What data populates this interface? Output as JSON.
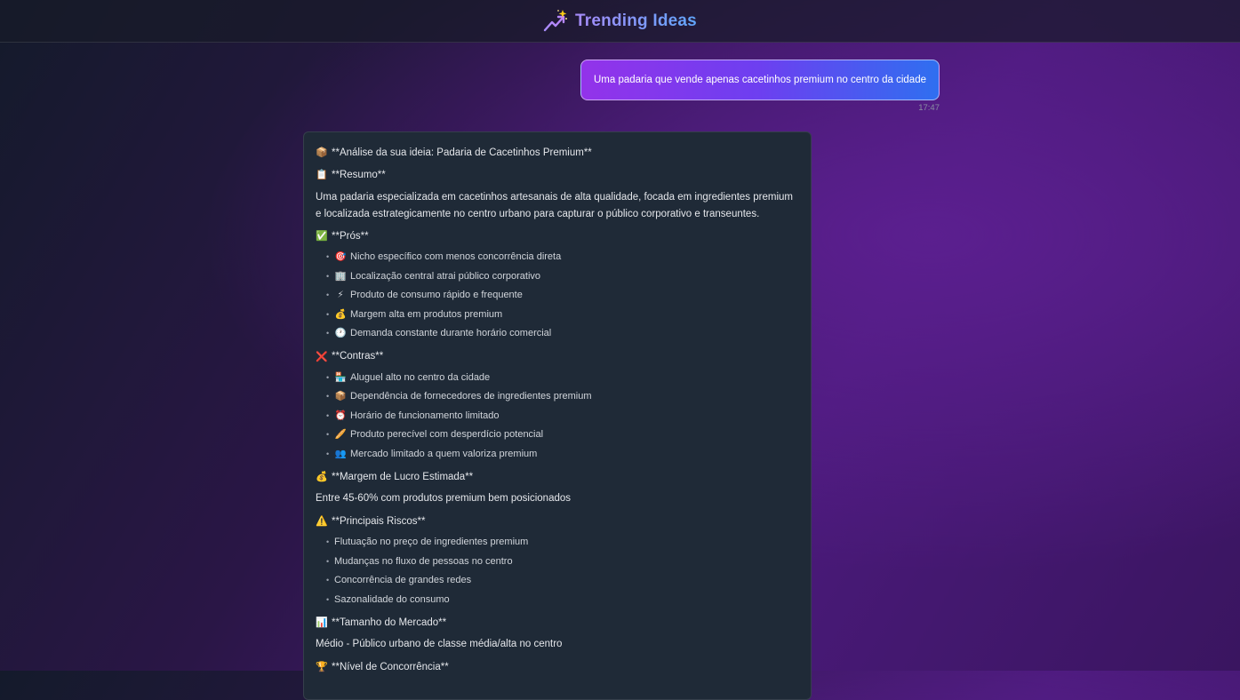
{
  "app": {
    "title": "Trending Ideas",
    "icon": "trending-up-sparkle-icon"
  },
  "user_message": {
    "text": "Uma padaria que vende apenas cacetinhos premium no centro da cidade",
    "time": "17:47"
  },
  "ai_response": {
    "title": {
      "emoji": "📦",
      "text": "**Análise da sua ideia: Padaria de Cacetinhos Premium**"
    },
    "summary_heading": {
      "emoji": "📋",
      "text": "**Resumo**"
    },
    "summary_text": "Uma padaria especializada em cacetinhos artesanais de alta qualidade, focada em ingredientes premium e localizada estrategicamente no centro urbano para capturar o público corporativo e transeuntes.",
    "pros_heading": {
      "emoji": "✅",
      "text": "**Prós**"
    },
    "pros": [
      {
        "emoji": "🎯",
        "text": "Nicho específico com menos concorrência direta"
      },
      {
        "emoji": "🏢",
        "text": "Localização central atrai público corporativo"
      },
      {
        "emoji": "⚡",
        "text": "Produto de consumo rápido e frequente"
      },
      {
        "emoji": "💰",
        "text": "Margem alta em produtos premium"
      },
      {
        "emoji": "🕐",
        "text": "Demanda constante durante horário comercial"
      }
    ],
    "cons_heading": {
      "emoji": "❌",
      "text": "**Contras**"
    },
    "cons": [
      {
        "emoji": "🏪",
        "text": "Aluguel alto no centro da cidade"
      },
      {
        "emoji": "📦",
        "text": "Dependência de fornecedores de ingredientes premium"
      },
      {
        "emoji": "⏰",
        "text": "Horário de funcionamento limitado"
      },
      {
        "emoji": "🥖",
        "text": "Produto perecível com desperdício potencial"
      },
      {
        "emoji": "👥",
        "text": "Mercado limitado a quem valoriza premium"
      }
    ],
    "margin_heading": {
      "emoji": "💰",
      "text": "**Margem de Lucro Estimada**"
    },
    "margin_text": "Entre 45-60% com produtos premium bem posicionados",
    "risks_heading": {
      "emoji": "⚠️",
      "text": "**Principais Riscos**"
    },
    "risks": [
      "Flutuação no preço de ingredientes premium",
      "Mudanças no fluxo de pessoas no centro",
      "Concorrência de grandes redes",
      "Sazonalidade do consumo"
    ],
    "market_heading": {
      "emoji": "📊",
      "text": "**Tamanho do Mercado**"
    },
    "market_text": "Médio - Público urbano de classe média/alta no centro",
    "competition_heading": {
      "emoji": "🏆",
      "text": "**Nível de Concorrência**"
    }
  }
}
